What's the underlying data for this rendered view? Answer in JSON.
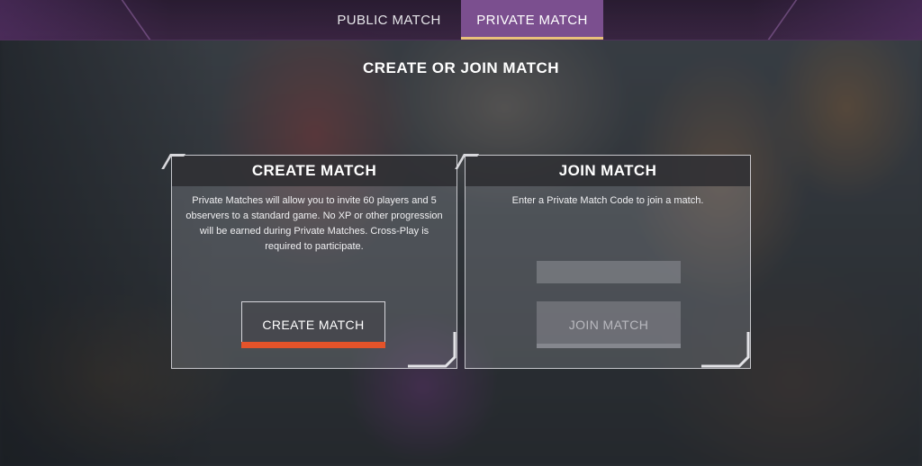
{
  "tabs": [
    {
      "label": "PUBLIC MATCH",
      "active": false
    },
    {
      "label": "PRIVATE MATCH",
      "active": true
    }
  ],
  "page_title": "CREATE OR JOIN MATCH",
  "create_panel": {
    "title": "CREATE MATCH",
    "description": "Private Matches will allow you to invite 60 players and 5 observers to a standard game. No XP or other progression will be earned during Private Matches. Cross-Play is required to participate.",
    "button_label": "CREATE MATCH"
  },
  "join_panel": {
    "title": "JOIN MATCH",
    "description": "Enter a Private Match Code to join a match.",
    "code_value": "",
    "button_label": "JOIN MATCH"
  },
  "colors": {
    "active_tab": "#7b4f8f",
    "tab_underline": "#e9c17a",
    "create_button_accent": "#e4532a"
  }
}
